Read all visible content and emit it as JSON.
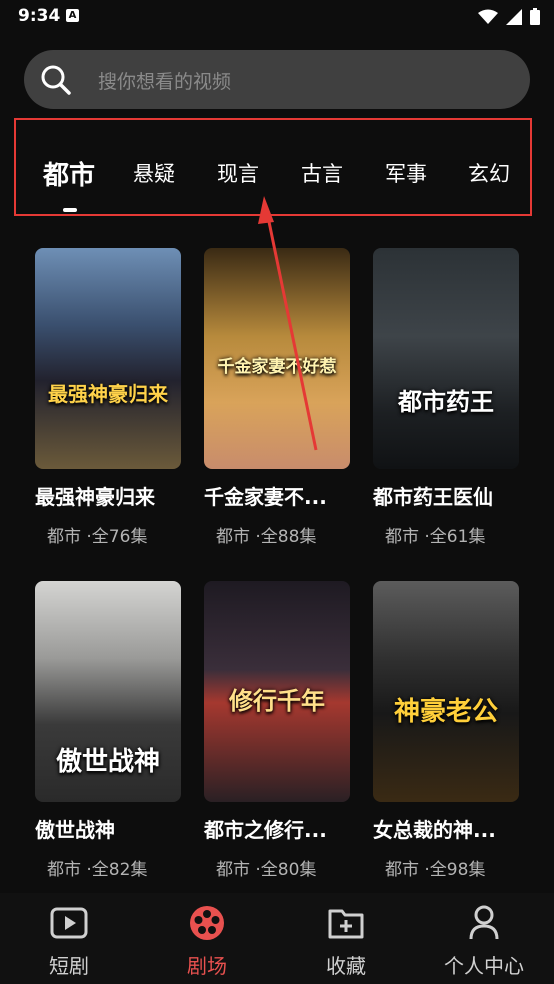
{
  "status": {
    "time": "9:34",
    "notif_icon": "A"
  },
  "search": {
    "placeholder": "搜你想看的视频"
  },
  "tabs": [
    {
      "label": "都市",
      "active": true
    },
    {
      "label": "悬疑"
    },
    {
      "label": "现言"
    },
    {
      "label": "古言"
    },
    {
      "label": "军事"
    },
    {
      "label": "玄幻"
    }
  ],
  "shows": [
    {
      "title": "最强神豪归来",
      "meta": "都市 ·全76集",
      "poster_text": "最强神豪归来"
    },
    {
      "title": "千金家妻不...",
      "meta": "都市 ·全88集",
      "poster_text": "千金家妻不好惹"
    },
    {
      "title": "都市药王医仙",
      "meta": "都市 ·全61集",
      "poster_text": "都市药王"
    },
    {
      "title": "傲世战神",
      "meta": "都市 ·全82集",
      "poster_text": "傲世战神"
    },
    {
      "title": "都市之修行...",
      "meta": "都市 ·全80集",
      "poster_text": "修行千年"
    },
    {
      "title": "女总裁的神...",
      "meta": "都市 ·全98集",
      "poster_text": "神豪老公"
    }
  ],
  "nav": [
    {
      "label": "短剧",
      "icon": "play-icon"
    },
    {
      "label": "剧场",
      "icon": "film-reel-icon",
      "active": true
    },
    {
      "label": "收藏",
      "icon": "folder-add-icon"
    },
    {
      "label": "个人中心",
      "icon": "person-icon"
    }
  ],
  "colors": {
    "accent": "#e8514f",
    "highlight_box": "#e53935",
    "background": "#0d0d0d"
  }
}
